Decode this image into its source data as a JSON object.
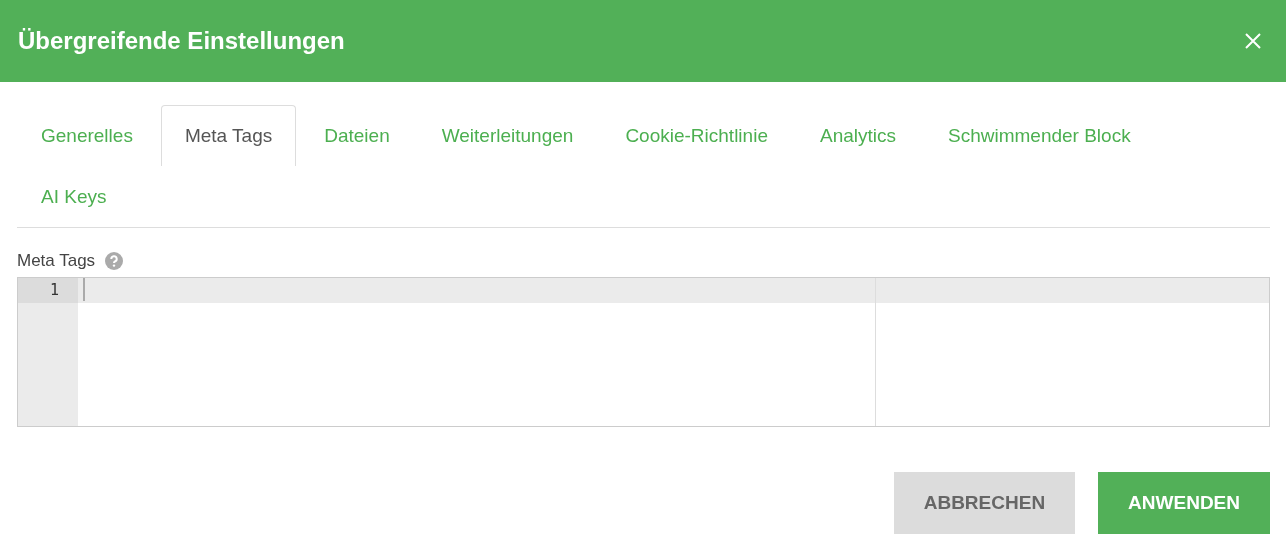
{
  "window": {
    "title": "Übergreifende Einstellungen"
  },
  "tabs": [
    {
      "label": "Generelles",
      "selected": false
    },
    {
      "label": "Meta Tags",
      "selected": true
    },
    {
      "label": "Dateien",
      "selected": false
    },
    {
      "label": "Weiterleitungen",
      "selected": false
    },
    {
      "label": "Cookie-Richtlinie",
      "selected": false
    },
    {
      "label": "Analytics",
      "selected": false
    },
    {
      "label": "Schwimmender Block",
      "selected": false
    },
    {
      "label": "AI Keys",
      "selected": false
    }
  ],
  "field": {
    "label": "Meta Tags",
    "line_numbers": [
      "1"
    ]
  },
  "buttons": [
    {
      "label": "ABBRECHEN",
      "kind": "secondary"
    },
    {
      "label": "ANWENDEN",
      "kind": "primary"
    }
  ]
}
